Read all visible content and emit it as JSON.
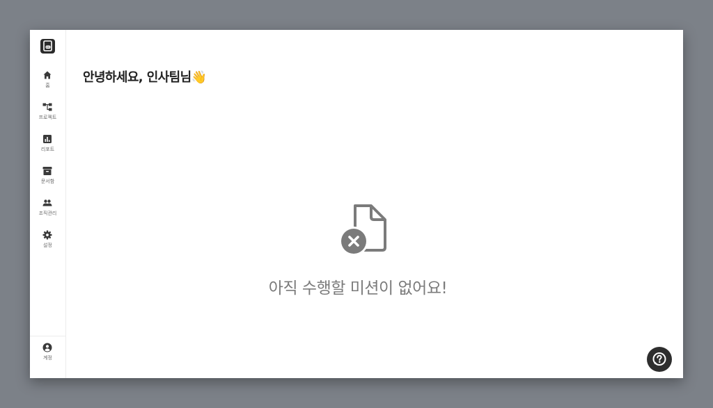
{
  "colors": {
    "backdrop": "#7c8188",
    "window_bg": "#ffffff",
    "icon_dark": "#3a3a3a",
    "empty_state_gray": "#7b7b7b",
    "help_button_bg": "#2e2e2e"
  },
  "sidebar": {
    "logo_icon": "app-logo-icon",
    "items": [
      {
        "icon": "home-icon",
        "label": "홈"
      },
      {
        "icon": "project-tree-icon",
        "label": "프로젝트"
      },
      {
        "icon": "bar-chart-icon",
        "label": "리포트"
      },
      {
        "icon": "archive-box-icon",
        "label": "문서함"
      },
      {
        "icon": "people-icon",
        "label": "조직관리"
      },
      {
        "icon": "gear-icon",
        "label": "설정"
      }
    ],
    "account": {
      "icon": "account-circle-icon",
      "label": "계정"
    }
  },
  "main": {
    "greeting": "안녕하세요, 인사팀님👋",
    "empty_state": {
      "icon": "file-error-icon",
      "message": "아직 수행할 미션이 없어요!"
    }
  },
  "help_button": {
    "icon": "help-question-icon"
  }
}
